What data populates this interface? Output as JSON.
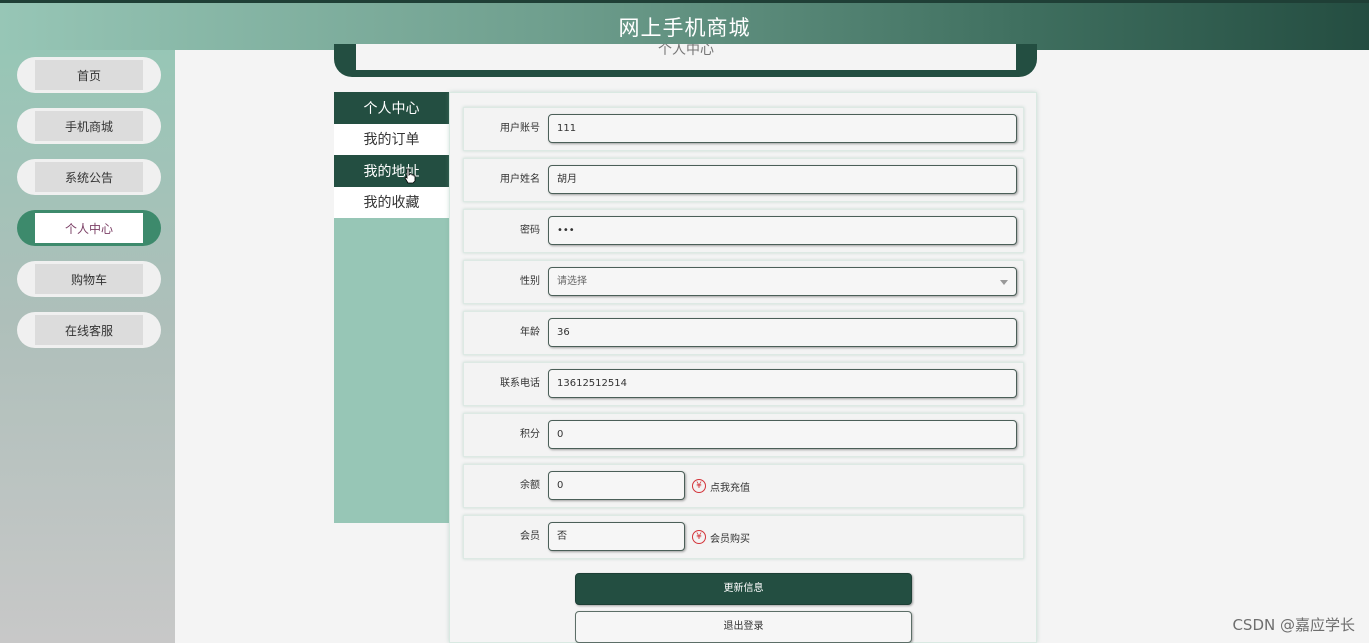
{
  "header": {
    "title": "网上手机商城"
  },
  "sidebar": {
    "items": [
      {
        "label": "首页",
        "active": false
      },
      {
        "label": "手机商城",
        "active": false
      },
      {
        "label": "系统公告",
        "active": false
      },
      {
        "label": "个人中心",
        "active": true
      },
      {
        "label": "购物车",
        "active": false
      },
      {
        "label": "在线客服",
        "active": false
      }
    ]
  },
  "banner": {
    "title": "个人中心"
  },
  "user_menu": {
    "items": [
      {
        "label": "个人中心"
      },
      {
        "label": "我的订单"
      },
      {
        "label": "我的地址"
      },
      {
        "label": "我的收藏"
      }
    ]
  },
  "form": {
    "username": {
      "label": "用户账号",
      "value": "111"
    },
    "name": {
      "label": "用户姓名",
      "value": "胡月"
    },
    "password": {
      "label": "密码",
      "value": "•••"
    },
    "gender": {
      "label": "性别",
      "value": "请选择"
    },
    "age": {
      "label": "年龄",
      "value": "36"
    },
    "phone": {
      "label": "联系电话",
      "value": "13612512514"
    },
    "points": {
      "label": "积分",
      "value": "0"
    },
    "balance": {
      "label": "余额",
      "value": "0",
      "link": "点我充值",
      "icon": "yen-icon"
    },
    "member": {
      "label": "会员",
      "value": "否",
      "link": "会员购买",
      "icon": "yen-icon"
    }
  },
  "buttons": {
    "update": "更新信息",
    "logout": "退出登录"
  },
  "watermark": "CSDN @嘉应学长",
  "colors": {
    "primary": "#234e41",
    "accent": "#97c6b6",
    "active_nav": "#3d8a6c",
    "yen": "#d3343a"
  }
}
